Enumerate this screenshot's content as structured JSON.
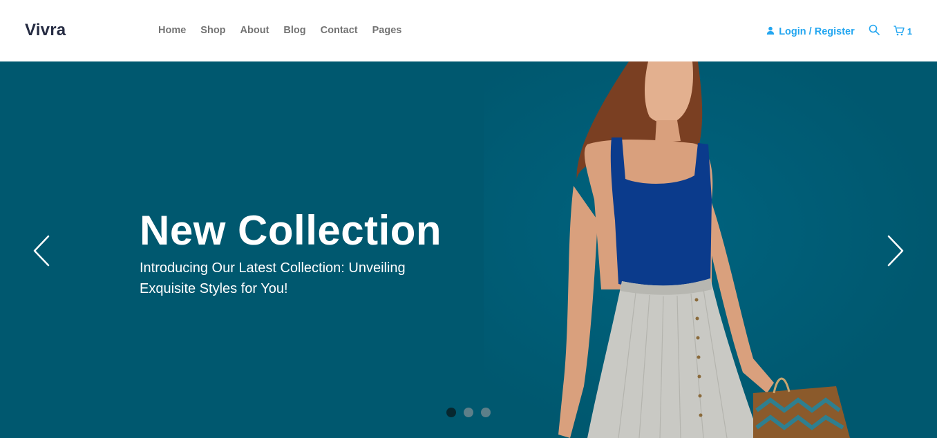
{
  "header": {
    "logo": "Vivra",
    "nav": [
      "Home",
      "Shop",
      "About",
      "Blog",
      "Contact",
      "Pages"
    ],
    "login_label": "Login / Register",
    "cart_count": "1",
    "icons": {
      "user": "user-icon",
      "search": "search-icon",
      "cart": "cart-icon"
    },
    "accent_color": "#23a6f0"
  },
  "hero": {
    "title": "New Collection",
    "subtitle": "Introducing Our Latest Collection: Unveiling Exquisite Styles for You!",
    "background_color": "#00586f",
    "slides_count": 3,
    "active_slide": 1,
    "icons": {
      "prev": "chevron-left-icon",
      "next": "chevron-right-icon"
    }
  }
}
